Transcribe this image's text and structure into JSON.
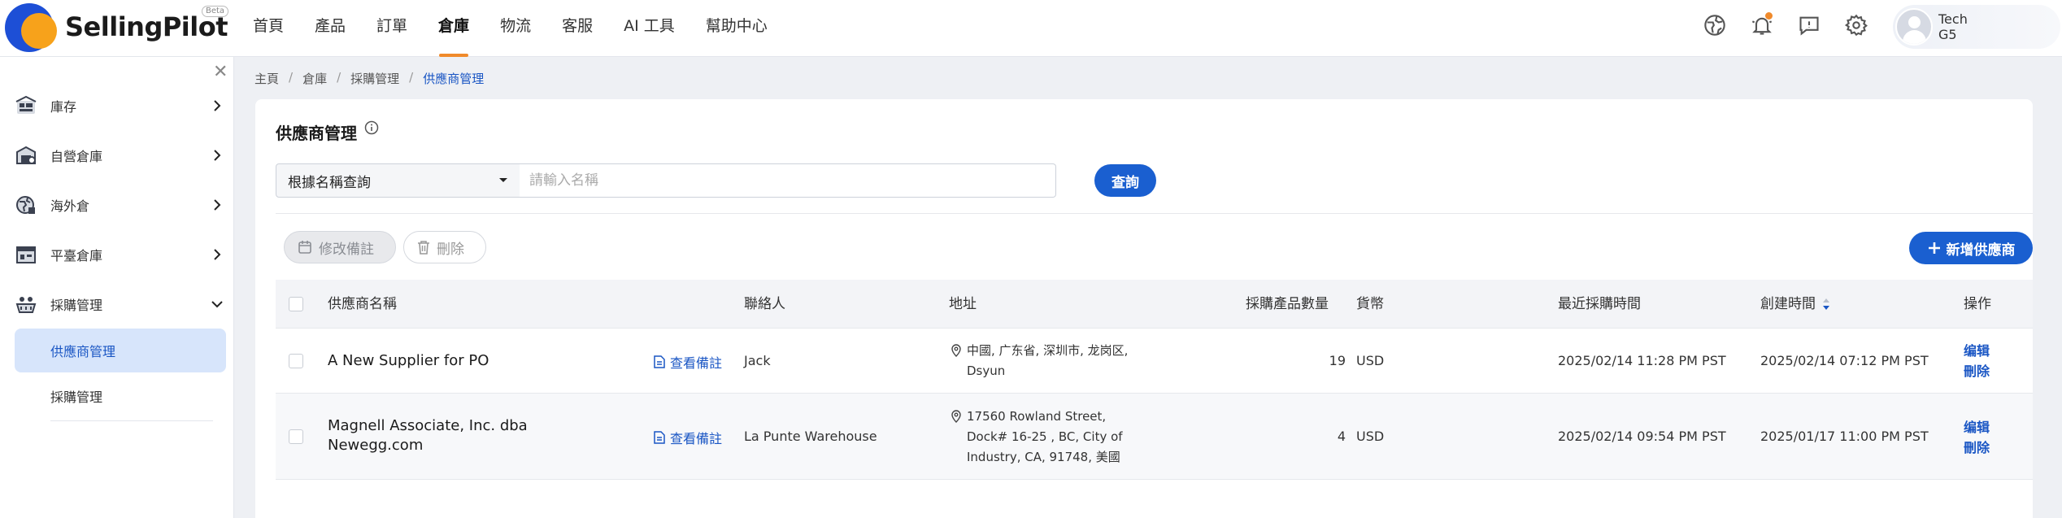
{
  "app": {
    "brand": "SellingPilot",
    "beta": "Beta"
  },
  "nav": {
    "items": [
      "首頁",
      "產品",
      "訂單",
      "倉庫",
      "物流",
      "客服",
      "AI 工具",
      "幫助中心"
    ],
    "active_index": 3
  },
  "user": {
    "name_line1": "Tech",
    "name_line2": "G5"
  },
  "top_icons": [
    "globe-icon",
    "bell-icon",
    "message-icon",
    "gear-icon"
  ],
  "sidebar": {
    "items": [
      {
        "label": "庫存",
        "icon": "inventory-icon",
        "expanded": false
      },
      {
        "label": "自營倉庫",
        "icon": "warehouse-icon",
        "expanded": false
      },
      {
        "label": "海外倉",
        "icon": "overseas-warehouse-icon",
        "expanded": false
      },
      {
        "label": "平臺倉庫",
        "icon": "platform-warehouse-icon",
        "expanded": false
      },
      {
        "label": "採購管理",
        "icon": "purchase-icon",
        "expanded": true
      }
    ],
    "sub_items": [
      {
        "label": "供應商管理",
        "active": true
      },
      {
        "label": "採購管理",
        "active": false
      }
    ]
  },
  "breadcrumb": {
    "items": [
      "主頁",
      "倉庫",
      "採購管理",
      "供應商管理"
    ],
    "separator": "/"
  },
  "page": {
    "title": "供應商管理"
  },
  "search": {
    "select_value": "根據名稱查詢",
    "placeholder": "請輸入名稱",
    "button": "查詢"
  },
  "toolbar": {
    "edit_note": "修改備註",
    "delete": "刪除",
    "add_supplier": "新增供應商"
  },
  "table": {
    "columns": [
      "供應商名稱",
      "聯絡人",
      "地址",
      "採購產品數量",
      "貨幣",
      "最近採購時間",
      "創建時間",
      "操作"
    ],
    "note_link": "查看備註",
    "actions": [
      "编辑",
      "刪除"
    ],
    "rows": [
      {
        "name": [
          "A New Supplier for PO"
        ],
        "contact": "Jack",
        "address": [
          "中國, 广东省, 深圳市, 龙岗区,",
          "Dsyun"
        ],
        "qty": "19",
        "currency": "USD",
        "last_purchase": "2025/02/14 11:28 PM PST",
        "created": "2025/02/14 07:12 PM PST"
      },
      {
        "name": [
          "Magnell Associate, Inc. dba",
          "Newegg.com"
        ],
        "contact": "La Punte Warehouse",
        "address": [
          "17560 Rowland Street,",
          "Dock# 16-25 , BC, City of",
          "Industry, CA, 91748, 美國"
        ],
        "qty": "4",
        "currency": "USD",
        "last_purchase": "2025/02/14 09:54 PM PST",
        "created": "2025/01/17 11:00 PM PST"
      }
    ]
  },
  "colors": {
    "accent": "#1a5fd0",
    "nav_active_underline": "#f08a2b",
    "link": "#1a56c4"
  }
}
